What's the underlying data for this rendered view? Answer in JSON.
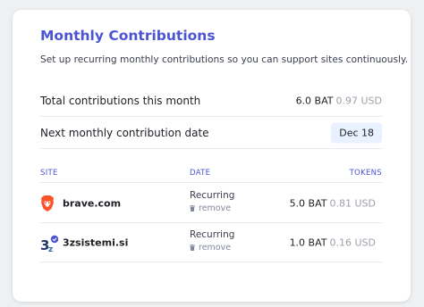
{
  "card": {
    "title": "Monthly Contributions",
    "subtitle": "Set up recurring monthly contributions so you can support sites continuously."
  },
  "summary": {
    "total": {
      "label": "Total contributions this month",
      "bat": "6.0 BAT",
      "usd": "0.97 USD"
    },
    "next": {
      "label": "Next monthly contribution date",
      "date": "Dec 18"
    }
  },
  "table": {
    "headers": {
      "site": "SITE",
      "date": "DATE",
      "tokens": "TOKENS"
    },
    "rows": [
      {
        "site": "brave.com",
        "icon": "brave-lion-icon",
        "date": "Recurring",
        "remove": "remove",
        "bat": "5.0 BAT",
        "usd": "0.81 USD",
        "verified": false
      },
      {
        "site": "3zsistemi.si",
        "icon": "3z-logo-icon",
        "date": "Recurring",
        "remove": "remove",
        "bat": "1.0 BAT",
        "usd": "0.16 USD",
        "verified": true
      }
    ]
  },
  "colors": {
    "accent": "#4c54d2",
    "verified_badge": "#4c54d2",
    "brave_orange": "#fb542b",
    "pill_bg": "#e9f0ff",
    "muted": "#9e9fab"
  }
}
